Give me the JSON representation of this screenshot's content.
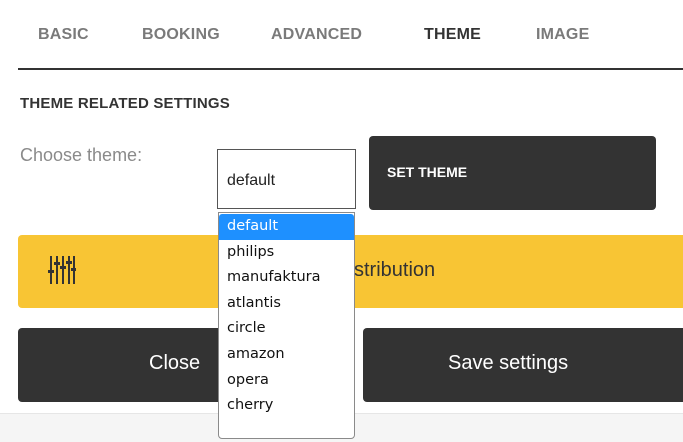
{
  "tabs": [
    {
      "label": "BASIC",
      "active": false
    },
    {
      "label": "BOOKING",
      "active": false
    },
    {
      "label": "ADVANCED",
      "active": false
    },
    {
      "label": "THEME",
      "active": true
    },
    {
      "label": "IMAGE",
      "active": false
    }
  ],
  "section": {
    "title": "THEME RELATED SETTINGS"
  },
  "theme_chooser": {
    "label": "Choose theme:",
    "selected": "default",
    "options": [
      "default",
      "philips",
      "manufaktura",
      "atlantis",
      "circle",
      "amazon",
      "opera",
      "cherry"
    ],
    "highlighted": "default",
    "dropdown_open": true,
    "set_button_label": "SET THEME"
  },
  "distribution": {
    "label_visible": "stribution",
    "icon": "sliders-icon"
  },
  "actions": {
    "close_label": "Close",
    "save_label": "Save settings"
  },
  "colors": {
    "accent_yellow": "#f8c534",
    "dark_button": "#333333",
    "selection_blue": "#1e90ff"
  }
}
